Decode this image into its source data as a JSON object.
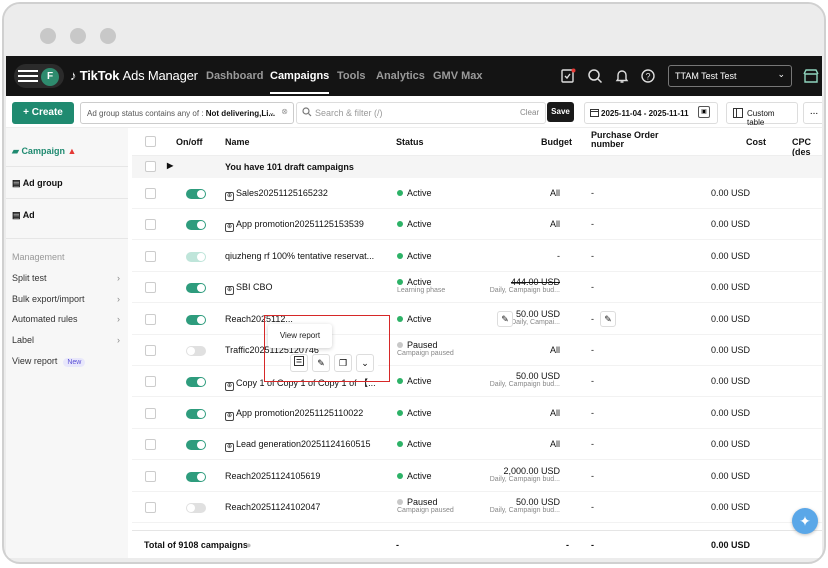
{
  "nav": {
    "avatar_letter": "F",
    "logo_brand": "TikTok",
    "logo_product": "Ads Manager",
    "items": [
      {
        "label": "Dashboard",
        "active": false
      },
      {
        "label": "Campaigns",
        "active": true
      },
      {
        "label": "Tools",
        "active": false
      },
      {
        "label": "Analytics",
        "active": false
      },
      {
        "label": "GMV Max",
        "active": false
      }
    ],
    "account_name": "TTAM Test Test"
  },
  "toolbar": {
    "create_label": "+ Create",
    "filter_prefix": "Ad group status contains any of : ",
    "filter_value": "Not delivering,Li...",
    "search_placeholder": "Search & filter (/)",
    "clear_label": "Clear",
    "save_label": "Save",
    "date_range": "2025-11-04 - 2025-11-11",
    "custom_table_label": "Custom table",
    "more_label": "..."
  },
  "sidebar": {
    "levels": [
      {
        "label": "Campaign",
        "active": true,
        "warning": true
      },
      {
        "label": "Ad group",
        "active": false
      },
      {
        "label": "Ad",
        "active": false
      }
    ],
    "management_label": "Management",
    "items": [
      {
        "label": "Split test",
        "arrow": true
      },
      {
        "label": "Bulk export/import",
        "arrow": true
      },
      {
        "label": "Automated rules",
        "arrow": true
      },
      {
        "label": "Label",
        "arrow": true
      },
      {
        "label": "View report",
        "badge": "New"
      }
    ]
  },
  "table": {
    "headers": {
      "onoff": "On/off",
      "name": "Name",
      "status": "Status",
      "budget": "Budget",
      "pon": "Purchase Order number",
      "cost": "Cost",
      "cpc": "CPC (des"
    },
    "draft_text": "You have 101 draft campaigns",
    "rows": [
      {
        "name": "Sales20251125165232",
        "app_icon": true,
        "toggle": "on",
        "status": "Active",
        "status_color": "green",
        "status_sub": "",
        "budget": "All",
        "budget_sub": "",
        "pon": "-",
        "cost": "0.00 USD"
      },
      {
        "name": "App promotion20251125153539",
        "app_icon": true,
        "toggle": "on",
        "status": "Active",
        "status_color": "green",
        "status_sub": "",
        "budget": "All",
        "budget_sub": "",
        "pon": "-",
        "cost": "0.00 USD"
      },
      {
        "name": "qiuzheng rf 100% tentative reservat...",
        "app_icon": false,
        "toggle": "faint",
        "status": "Active",
        "status_color": "green",
        "status_sub": "",
        "budget": "-",
        "budget_sub": "",
        "pon": "-",
        "cost": "0.00 USD"
      },
      {
        "name": "SBI CBO",
        "app_icon": true,
        "toggle": "on",
        "status": "Active",
        "status_color": "green",
        "status_sub": "Learning phase",
        "budget": "444.00 USD",
        "budget_strike": true,
        "budget_sub": "Daily, Campaign bud...",
        "pon": "-",
        "cost": "0.00 USD"
      },
      {
        "name": "Reach2025112...",
        "app_icon": false,
        "toggle": "on",
        "status": "Active",
        "status_color": "green",
        "status_sub": "",
        "budget": "50.00 USD",
        "budget_sub": "Daily, Campai...",
        "pon": "-",
        "cost": "0.00 USD"
      },
      {
        "name": "Traffic20251125120746",
        "app_icon": false,
        "toggle": "off",
        "status": "Paused",
        "status_color": "grey",
        "status_sub": "Campaign paused",
        "budget": "All",
        "budget_sub": "",
        "pon": "-",
        "cost": "0.00 USD"
      },
      {
        "name": "Copy 1 of Copy 1 of Copy 1 of 【...",
        "app_icon": true,
        "toggle": "on",
        "status": "Active",
        "status_color": "green",
        "status_sub": "",
        "budget": "50.00 USD",
        "budget_sub": "Daily, Campaign bud...",
        "pon": "-",
        "cost": "0.00 USD"
      },
      {
        "name": "App promotion20251125110022",
        "app_icon": true,
        "toggle": "on",
        "status": "Active",
        "status_color": "green",
        "status_sub": "",
        "budget": "All",
        "budget_sub": "",
        "pon": "-",
        "cost": "0.00 USD"
      },
      {
        "name": "Lead generation20251124160515",
        "app_icon": true,
        "toggle": "on",
        "status": "Active",
        "status_color": "green",
        "status_sub": "",
        "budget": "All",
        "budget_sub": "",
        "pon": "-",
        "cost": "0.00 USD"
      },
      {
        "name": "Reach20251124105619",
        "app_icon": false,
        "toggle": "on",
        "status": "Active",
        "status_color": "green",
        "status_sub": "",
        "budget": "2,000.00 USD",
        "budget_sub": "Daily, Campaign bud...",
        "pon": "-",
        "cost": "0.00 USD"
      },
      {
        "name": "Reach20251124102047",
        "app_icon": false,
        "toggle": "off",
        "status": "Paused",
        "status_color": "grey",
        "status_sub": "Campaign paused",
        "budget": "50.00 USD",
        "budget_sub": "Daily, Campaign bud...",
        "pon": "-",
        "cost": "0.00 USD"
      }
    ],
    "total": {
      "label": "Total of 9108 campaigns",
      "status": "-",
      "budget": "-",
      "pon": "-",
      "cost": "0.00 USD"
    }
  },
  "tooltip": {
    "text": "View report"
  },
  "colors": {
    "accent": "#1f8a70",
    "active_status": "#2db267",
    "highlight_box": "#d62828"
  }
}
